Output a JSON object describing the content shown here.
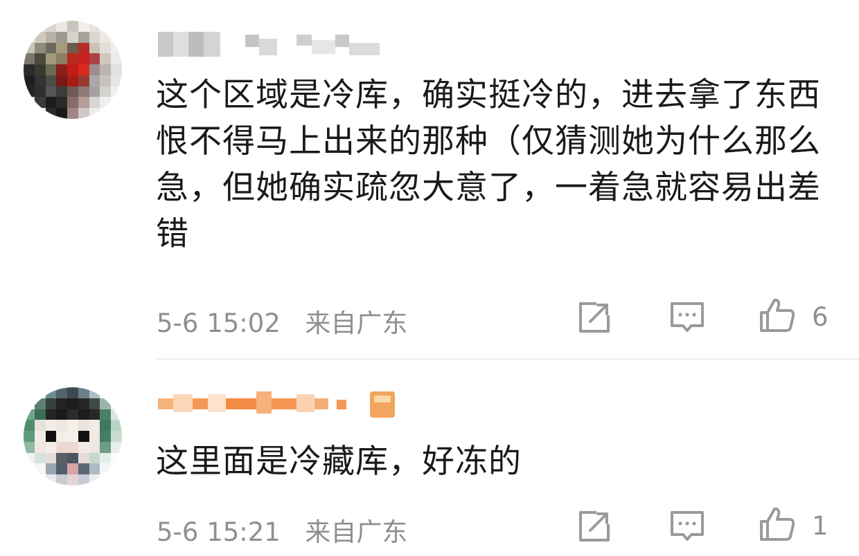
{
  "comments": [
    {
      "text": "这个区域是冷库，确实挺冷的，进去拿了东西恨不得马上出来的那种（仅猜测她为什么那么急，但她确实疏忽大意了，一着急就容易出差错",
      "time": "5-6 15:02",
      "location": "来自广东",
      "likes": "6",
      "username_censored": true
    },
    {
      "text": "这里面是冷藏库，好冻的",
      "time": "5-6 15:21",
      "location": "来自广东",
      "likes": "1",
      "username_censored": true
    }
  ],
  "icons": {
    "share": "share-icon",
    "reply": "comment-icon",
    "like": "thumbs-up-icon"
  },
  "colors": {
    "text": "#1a1a1a",
    "meta": "#8f8f8f",
    "icon": "#9a9a9a",
    "vip_username": "#f0883a",
    "divider": "#ececec"
  }
}
